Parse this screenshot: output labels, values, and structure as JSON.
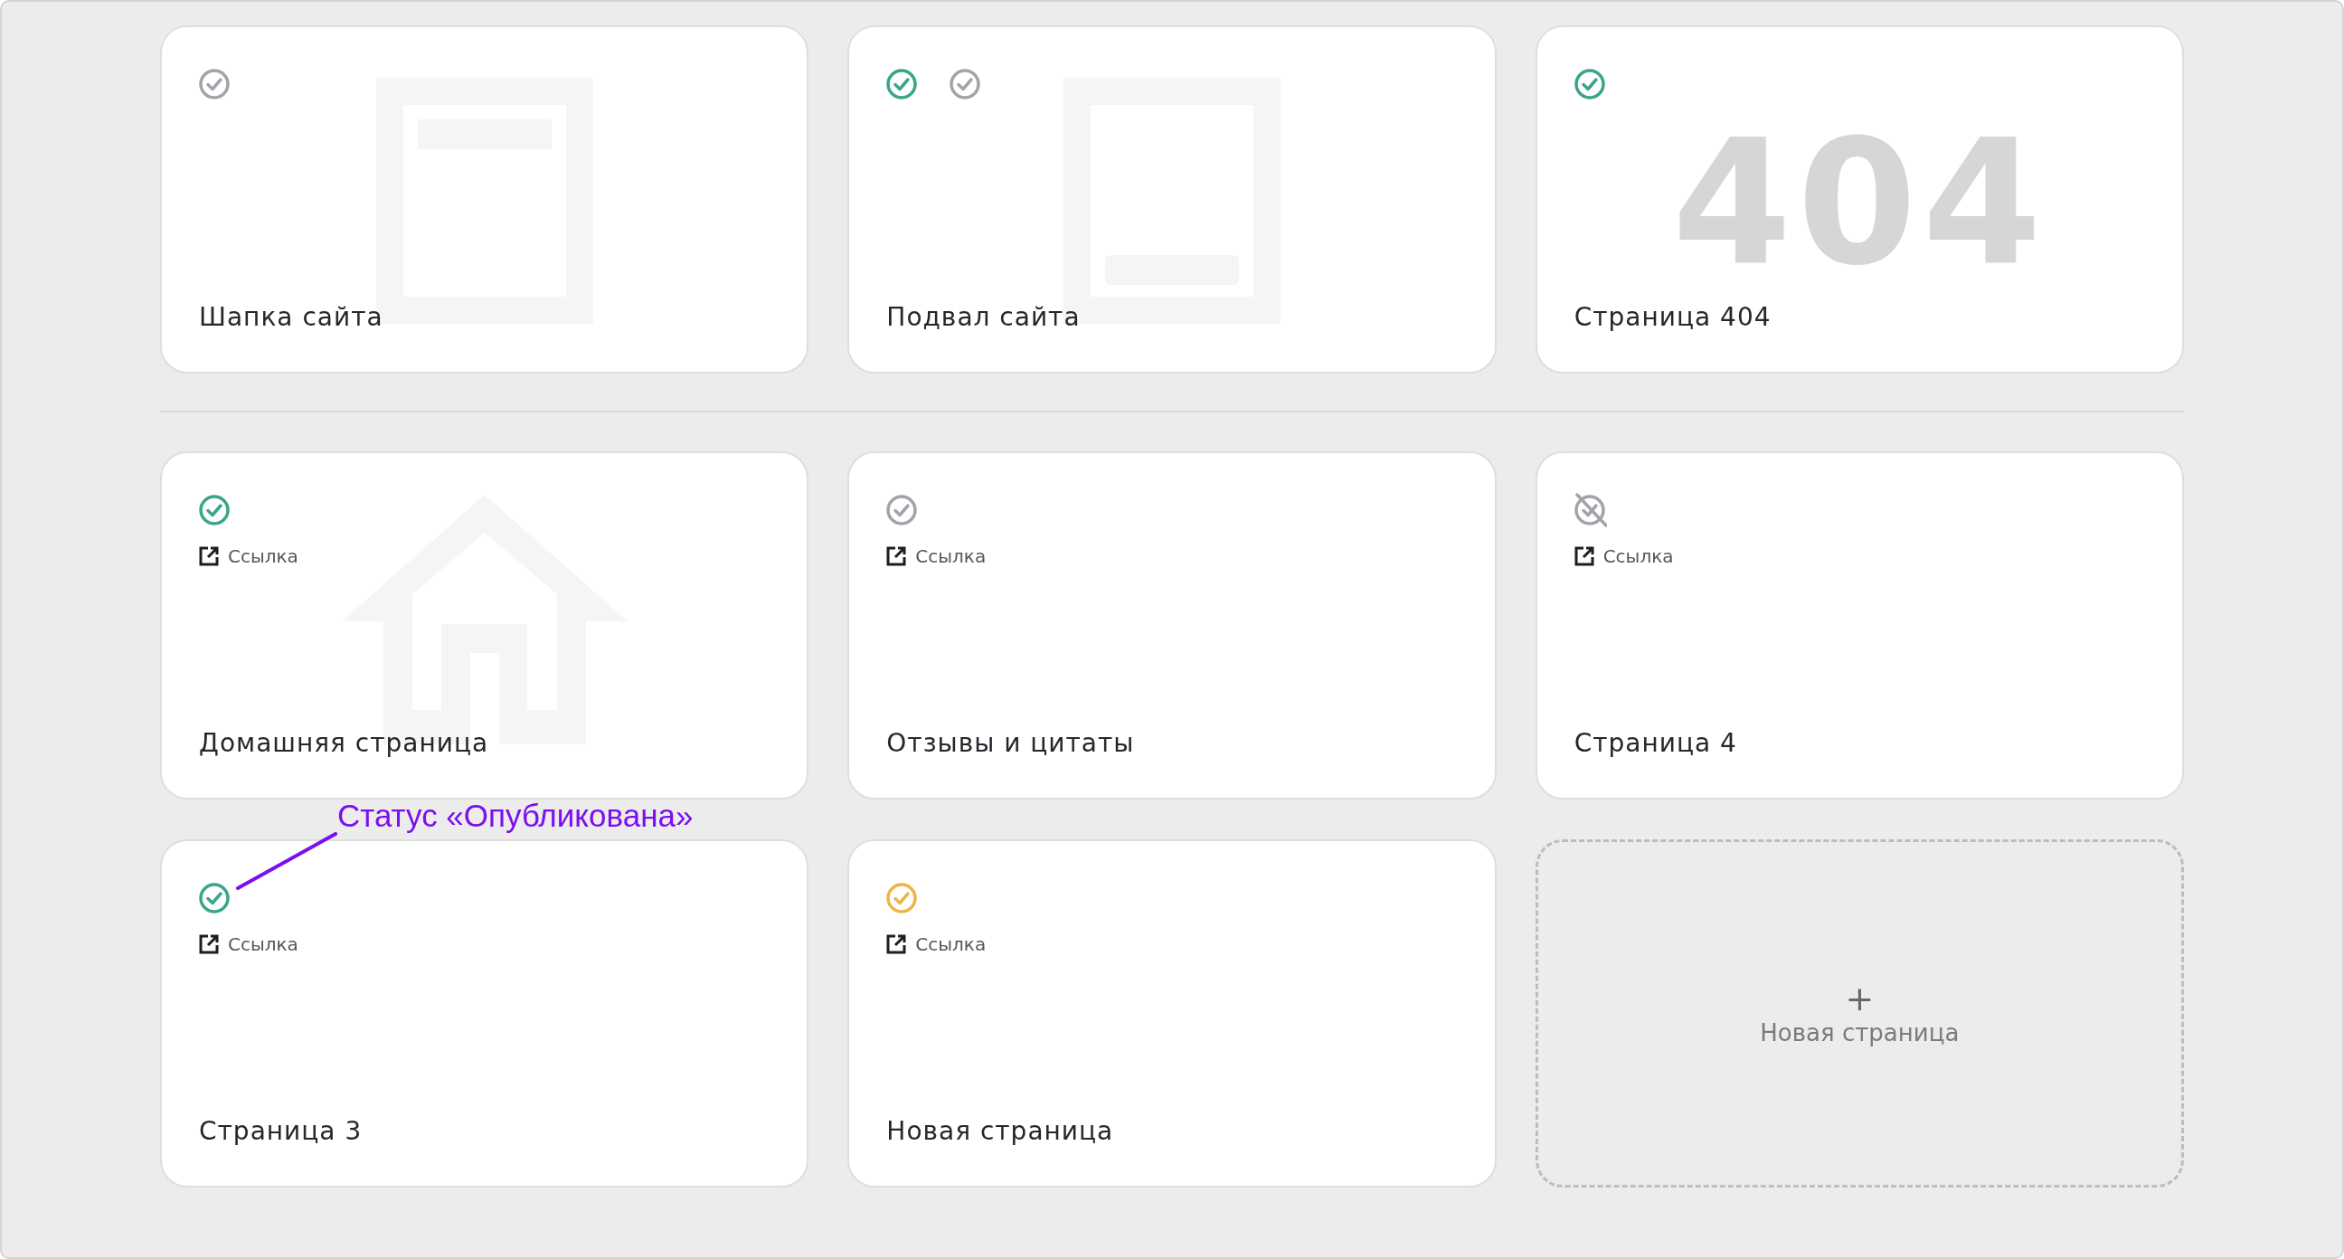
{
  "sections": [
    {
      "cards": [
        {
          "kind": "page",
          "title": "Шапка сайта",
          "illustration": {
            "kind": "header"
          },
          "statuses": [
            {
              "kind": "unpublished"
            }
          ]
        },
        {
          "kind": "page",
          "title": "Подвал сайта",
          "illustration": {
            "kind": "footer"
          },
          "statuses": [
            {
              "kind": "published"
            },
            {
              "kind": "unpublished"
            }
          ]
        },
        {
          "kind": "page",
          "title": "Страница 404",
          "illustration": {
            "kind": "error",
            "text": "404"
          },
          "statuses": [
            {
              "kind": "published"
            }
          ]
        }
      ]
    },
    {
      "cards": [
        {
          "kind": "page",
          "title": "Домашняя страница",
          "illustration": {
            "kind": "home"
          },
          "link": "Ссылка",
          "statuses": [
            {
              "kind": "published"
            }
          ]
        },
        {
          "kind": "page",
          "title": "Отзывы и цитаты",
          "link": "Ссылка",
          "statuses": [
            {
              "kind": "unpublished"
            }
          ]
        },
        {
          "kind": "page",
          "title": "Страница 4",
          "link": "Ссылка",
          "statuses": [
            {
              "kind": "hidden"
            }
          ]
        },
        {
          "kind": "page",
          "title": "Страница 3",
          "link": "Ссылка",
          "annotation": "Статус «Опубликована»",
          "statuses": [
            {
              "kind": "published"
            }
          ]
        },
        {
          "kind": "page",
          "title": "Новая страница",
          "link": "Ссылка",
          "statuses": [
            {
              "kind": "changed"
            }
          ]
        },
        {
          "kind": "add",
          "symbol": "+",
          "title": "Новая страница"
        }
      ]
    }
  ]
}
